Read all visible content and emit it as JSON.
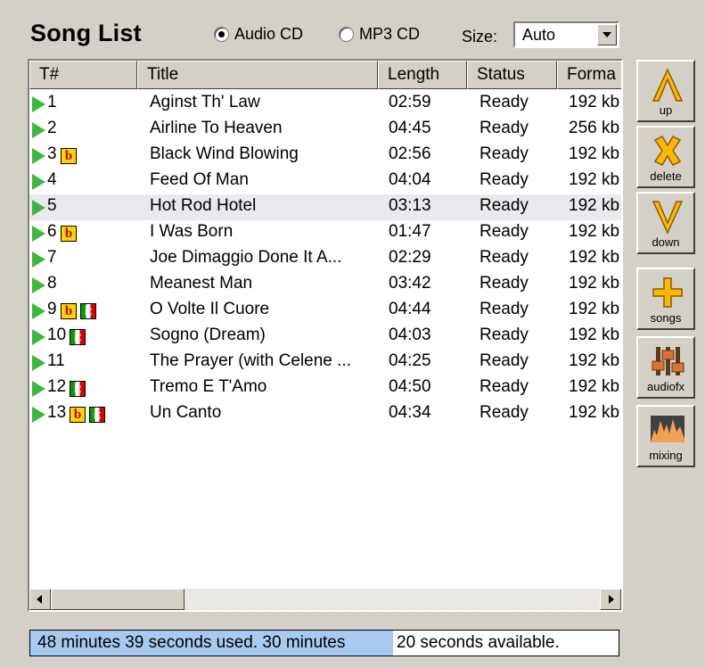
{
  "header": {
    "title": "Song List",
    "radio_audio": "Audio CD",
    "radio_mp3": "MP3 CD",
    "size_label": "Size:",
    "size_value": "Auto"
  },
  "columns": [
    "T#",
    "Title",
    "Length",
    "Status",
    "Forma"
  ],
  "rows": [
    {
      "num": "1",
      "title": "Aginst Th' Law",
      "length": "02:59",
      "status": "Ready",
      "format": "192 kb",
      "badges": []
    },
    {
      "num": "2",
      "title": "Airline To Heaven",
      "length": "04:45",
      "status": "Ready",
      "format": "256 kb",
      "badges": []
    },
    {
      "num": "3",
      "title": "Black Wind Blowing",
      "length": "02:56",
      "status": "Ready",
      "format": "192 kb",
      "badges": [
        "b"
      ]
    },
    {
      "num": "4",
      "title": "Feed Of Man",
      "length": "04:04",
      "status": "Ready",
      "format": "192 kb",
      "badges": []
    },
    {
      "num": "5",
      "title": "Hot Rod Hotel",
      "length": "03:13",
      "status": "Ready",
      "format": "192 kb",
      "badges": []
    },
    {
      "num": "6",
      "title": "I Was Born",
      "length": "01:47",
      "status": "Ready",
      "format": "192 kb",
      "badges": [
        "b"
      ]
    },
    {
      "num": "7",
      "title": "Joe Dimaggio Done It A...",
      "length": "02:29",
      "status": "Ready",
      "format": "192 kb",
      "badges": []
    },
    {
      "num": "8",
      "title": "Meanest Man",
      "length": "03:42",
      "status": "Ready",
      "format": "192 kb",
      "badges": []
    },
    {
      "num": "9",
      "title": "O Volte Il Cuore",
      "length": "04:44",
      "status": "Ready",
      "format": "192 kb",
      "badges": [
        "b",
        "it"
      ]
    },
    {
      "num": "10",
      "title": "Sogno (Dream)",
      "length": "04:03",
      "status": "Ready",
      "format": "192 kb",
      "badges": [
        "it"
      ]
    },
    {
      "num": "11",
      "title": "The Prayer (with Celene ...",
      "length": "04:25",
      "status": "Ready",
      "format": "192 kb",
      "badges": []
    },
    {
      "num": "12",
      "title": "Tremo E T'Amo",
      "length": "04:50",
      "status": "Ready",
      "format": "192 kb",
      "badges": [
        "it"
      ]
    },
    {
      "num": "13",
      "title": "Un Canto",
      "length": "04:34",
      "status": "Ready",
      "format": "192 kb",
      "badges": [
        "b",
        "it"
      ]
    }
  ],
  "badge_text": {
    "b": "b",
    "it": "it"
  },
  "status": {
    "used_text": "48 minutes 39 seconds used.  30 minutes",
    "avail_text": "20 seconds available."
  },
  "side_buttons": [
    {
      "label": "up",
      "icon": "arrow-up-icon"
    },
    {
      "label": "delete",
      "icon": "x-delete-icon"
    },
    {
      "label": "down",
      "icon": "arrow-down-icon"
    },
    {
      "label": "songs",
      "icon": "plus-icon"
    },
    {
      "label": "audiofx",
      "icon": "equalizer-icon"
    },
    {
      "label": "mixing",
      "icon": "waveform-icon"
    }
  ],
  "colors": {
    "play": "#3cb93c",
    "accent": "#ffb800",
    "used_bar": "#a6caf0"
  }
}
